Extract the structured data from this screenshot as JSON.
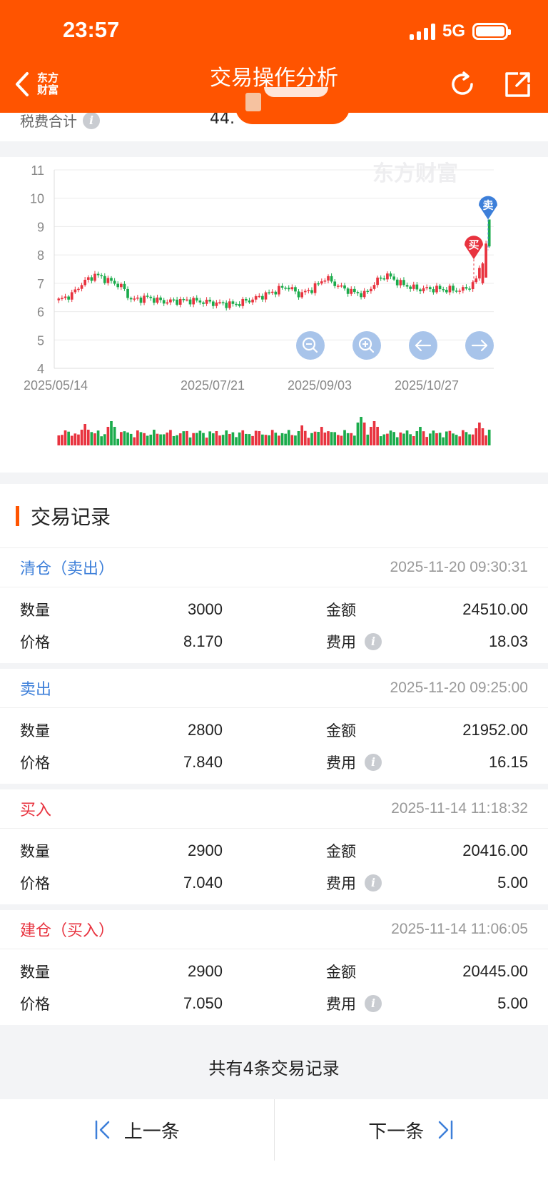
{
  "status_bar": {
    "time": "23:57",
    "network": "5G"
  },
  "header": {
    "title": "交易操作分析",
    "brand_line1": "东方",
    "brand_line2": "财富"
  },
  "summary": {
    "label": "税费合计",
    "value": "44."
  },
  "chart_data": {
    "type": "candlestick",
    "watermark": "东方财富",
    "ylim": [
      4,
      11
    ],
    "yticks": [
      "11",
      "10",
      "9",
      "8",
      "7",
      "6",
      "5",
      "4"
    ],
    "x_labels": [
      "2025/05/14",
      "2025/07/21",
      "2025/09/03",
      "2025/10/27"
    ],
    "markers": [
      {
        "label": "买",
        "date": "2025-11-14",
        "price": 7.04
      },
      {
        "label": "卖",
        "date": "2025-11-20",
        "price": 8.17
      }
    ],
    "up_color": "#e8333f",
    "down_color": "#1aab4b",
    "zoom_controls": [
      "zoom-out-icon",
      "zoom-in-icon",
      "arrow-left-icon",
      "arrow-right-icon"
    ]
  },
  "records_section": {
    "title": "交易记录"
  },
  "labels": {
    "qty": "数量",
    "amount": "金额",
    "price": "价格",
    "fee": "费用"
  },
  "records": [
    {
      "type": "清仓（卖出）",
      "side": "sell",
      "time": "2025-11-20 09:30:31",
      "qty": "3000",
      "amount": "24510.00",
      "price": "8.170",
      "fee": "18.03"
    },
    {
      "type": "卖出",
      "side": "sell",
      "time": "2025-11-20 09:25:00",
      "qty": "2800",
      "amount": "21952.00",
      "price": "7.840",
      "fee": "16.15"
    },
    {
      "type": "买入",
      "side": "buy",
      "time": "2025-11-14 11:18:32",
      "qty": "2900",
      "amount": "20416.00",
      "price": "7.040",
      "fee": "5.00"
    },
    {
      "type": "建仓（买入）",
      "side": "buy",
      "time": "2025-11-14 11:06:05",
      "qty": "2900",
      "amount": "20445.00",
      "price": "7.050",
      "fee": "5.00"
    }
  ],
  "total_text": "共有4条交易记录",
  "pager": {
    "prev": "上一条",
    "next": "下一条"
  },
  "colors": {
    "accent": "#ff5400",
    "sell": "#3d7fd9",
    "buy": "#e8333f"
  }
}
